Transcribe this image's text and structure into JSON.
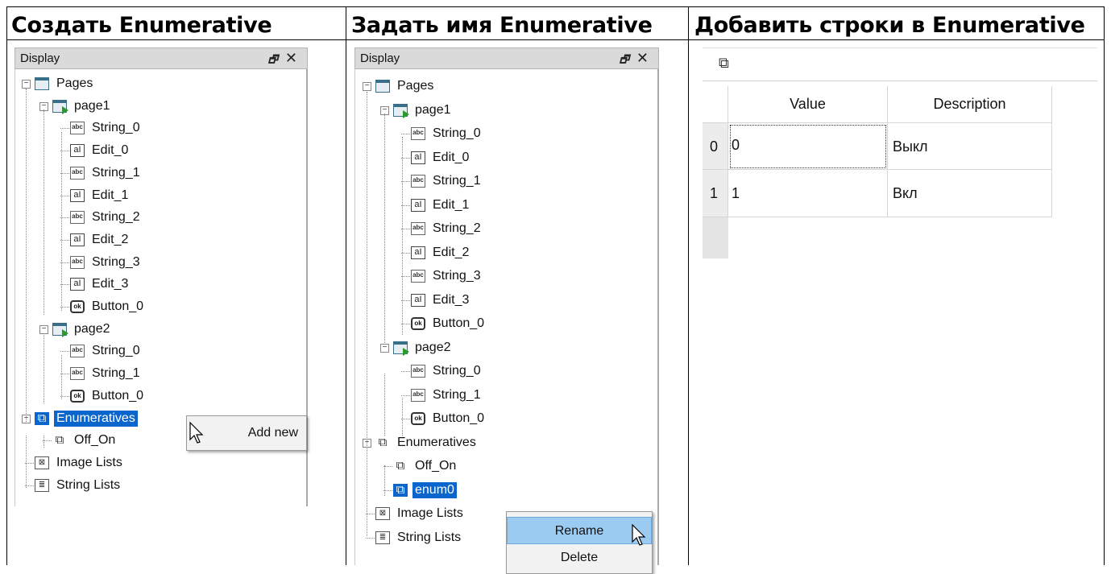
{
  "headers": [
    "Создать Enumerative",
    "Задать имя Enumerative",
    "Добавить строки в Enumerative"
  ],
  "panel": {
    "title": "Display",
    "float_glyph": "🗗",
    "close_glyph": "✕"
  },
  "tree1": {
    "pages": "Pages",
    "page1": "page1",
    "page1_items": [
      "String_0",
      "Edit_0",
      "String_1",
      "Edit_1",
      "String_2",
      "Edit_2",
      "String_3",
      "Edit_3",
      "Button_0"
    ],
    "page2": "page2",
    "page2_items": [
      "String_0",
      "String_1",
      "Button_0"
    ],
    "enumeratives": "Enumeratives",
    "enum_items": [
      "Off_On"
    ],
    "image_lists": "Image Lists",
    "string_lists": "String Lists",
    "context_menu": [
      "Add new"
    ]
  },
  "tree2": {
    "pages": "Pages",
    "page1": "page1",
    "page1_items": [
      "String_0",
      "Edit_0",
      "String_1",
      "Edit_1",
      "String_2",
      "Edit_2",
      "String_3",
      "Edit_3",
      "Button_0"
    ],
    "page2": "page2",
    "page2_items": [
      "String_0",
      "String_1",
      "Button_0"
    ],
    "enumeratives": "Enumeratives",
    "enum_items": [
      "Off_On",
      "enum0"
    ],
    "image_lists": "Image Lists",
    "string_lists": "String Lists",
    "context_menu": [
      "Rename",
      "Delete"
    ]
  },
  "icons": {
    "abc": "abc",
    "edit": "aI",
    "ok": "ok",
    "enum": "⧉",
    "image": "⊠",
    "string": "≣"
  },
  "enum_table": {
    "toolbar_icon": "⧉",
    "columns": [
      "Value",
      "Description"
    ],
    "rows": [
      {
        "index": "0",
        "value": "0",
        "description": "Выкл"
      },
      {
        "index": "1",
        "value": "1",
        "description": "Вкл"
      }
    ]
  },
  "colors": {
    "selection": "#0a66cc",
    "menu_highlight": "#9ccbf2"
  }
}
